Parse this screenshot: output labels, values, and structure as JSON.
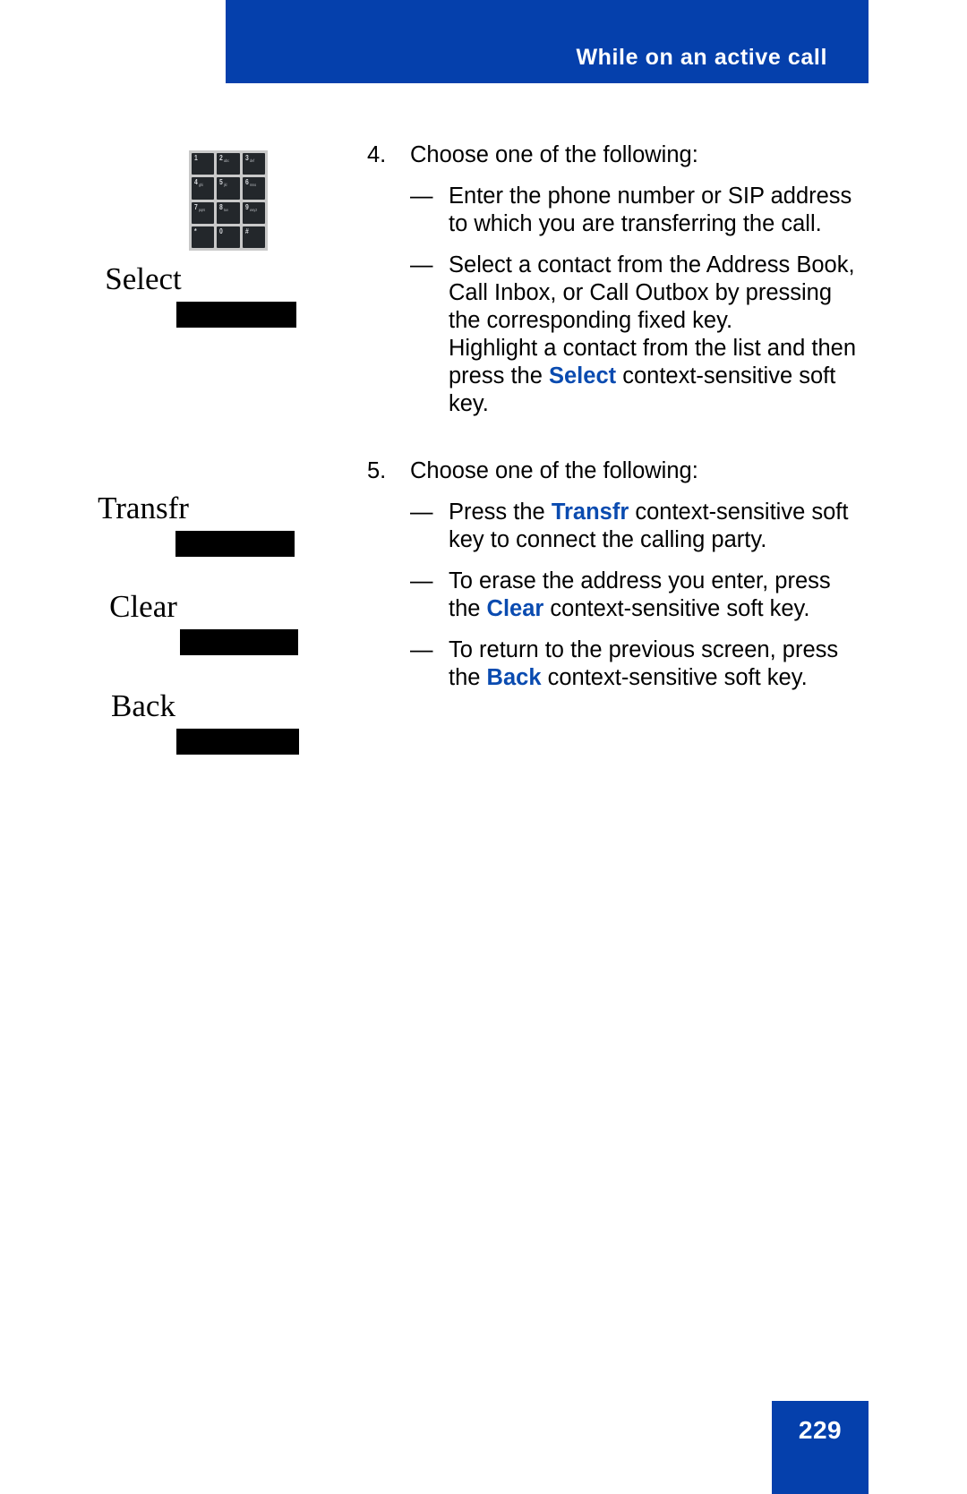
{
  "header": {
    "title": "While on an active call",
    "background_color": "#0540ac",
    "text_color": "#ffffff"
  },
  "keypad": {
    "name": "phone-keypad-image",
    "rows": [
      [
        {
          "digit": "1",
          "letters": ""
        },
        {
          "digit": "2",
          "letters": "abc"
        },
        {
          "digit": "3",
          "letters": "def"
        }
      ],
      [
        {
          "digit": "4",
          "letters": "ghi"
        },
        {
          "digit": "5",
          "letters": "jkl"
        },
        {
          "digit": "6",
          "letters": "mno"
        }
      ],
      [
        {
          "digit": "7",
          "letters": "pqrs"
        },
        {
          "digit": "8",
          "letters": "tuv"
        },
        {
          "digit": "9",
          "letters": "wxyz"
        }
      ],
      [
        {
          "digit": "*",
          "letters": ""
        },
        {
          "digit": "0",
          "letters": ""
        },
        {
          "digit": "#",
          "letters": ""
        }
      ]
    ]
  },
  "soft_keys": [
    {
      "label": "Select"
    },
    {
      "label": "Transfr"
    },
    {
      "label": "Clear"
    },
    {
      "label": "Back"
    }
  ],
  "steps": [
    {
      "number": "4.",
      "text": "Choose one of the following:",
      "bullets": [
        {
          "dash": "—",
          "segments": [
            {
              "text": "Enter the phone number or SIP address to which you are transferring the call.",
              "style": "normal"
            }
          ]
        },
        {
          "dash": "—",
          "segments": [
            {
              "text": "Select a contact from the Address Book, Call Inbox, or Call Outbox by pressing the corresponding fixed key.",
              "style": "normal"
            },
            {
              "text": "Highlight a contact from the list and then press the ",
              "style": "normal",
              "newline": true
            },
            {
              "text": "Select",
              "style": "keyword"
            },
            {
              "text": " context-sensitive soft key.",
              "style": "normal"
            }
          ]
        }
      ]
    },
    {
      "number": "5.",
      "text": "Choose one of the following:",
      "bullets": [
        {
          "dash": "—",
          "segments": [
            {
              "text": "Press the ",
              "style": "normal"
            },
            {
              "text": "Transfr",
              "style": "keyword"
            },
            {
              "text": " context-sensitive soft key to connect the calling party.",
              "style": "normal"
            }
          ]
        },
        {
          "dash": "—",
          "segments": [
            {
              "text": "To erase the address you enter, press the ",
              "style": "normal"
            },
            {
              "text": "Clear",
              "style": "keyword"
            },
            {
              "text": " context-sensitive soft key.",
              "style": "normal"
            }
          ]
        },
        {
          "dash": "—",
          "segments": [
            {
              "text": "To return to the previous screen, press the ",
              "style": "normal"
            },
            {
              "text": "Back",
              "style": "keyword"
            },
            {
              "text": " context-sensitive soft key.",
              "style": "normal"
            }
          ]
        }
      ]
    }
  ],
  "text_fragments": {
    "step4_num": "4.",
    "step4_lead": "Choose one of the following:",
    "b1_dash": "—",
    "b1_text": "Enter the phone number or SIP address to which you are transferring the call.",
    "b2_dash": "—",
    "b2_part1": "Select a contact from the Address Book, Call Inbox, or Call Outbox by pressing the corresponding fixed key.",
    "b2_part2": "Highlight a contact from the list and then press the ",
    "b2_kw": "Select",
    "b2_part3": " context-sensitive soft key.",
    "step5_num": "5.",
    "step5_lead": "Choose one of the following:",
    "b3_dash": "—",
    "b3_part1": "Press the ",
    "b3_kw": "Transfr",
    "b3_part2": " context-sensitive soft key to connect the calling party.",
    "b4_dash": "—",
    "b4_part1": "To erase the address you enter, press the ",
    "b4_kw": "Clear",
    "b4_part2": " context-sensitive soft key.",
    "b5_dash": "—",
    "b5_part1": "To return to the previous screen, press the ",
    "b5_kw": "Back",
    "b5_part2": " context-sensitive soft key."
  },
  "footer": {
    "page_number": "229",
    "background_color": "#0540ac",
    "text_color": "#ffffff"
  },
  "colors": {
    "brand_blue": "#0540ac",
    "keyword_blue": "#0a4bb0",
    "body_text": "#000000",
    "page_background": "#ffffff"
  }
}
